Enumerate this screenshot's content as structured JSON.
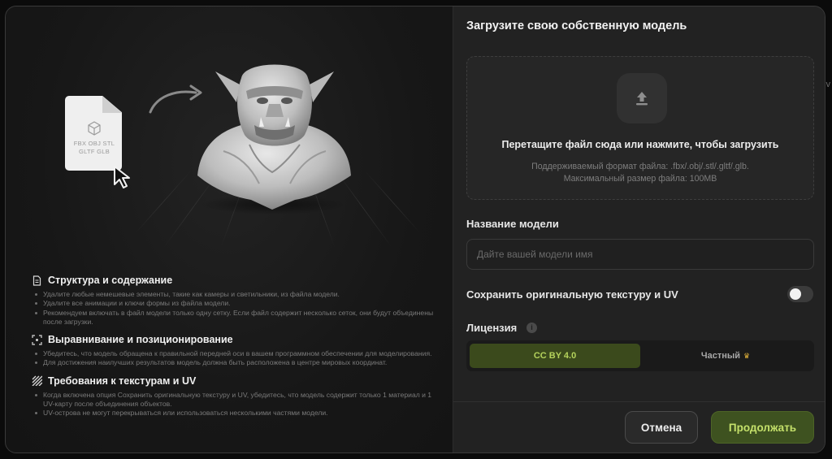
{
  "background": {
    "edge_text": "v"
  },
  "illustration": {
    "file_formats": [
      "FBX OBJ STL",
      "GLTF GLB"
    ],
    "icons": [
      "file-icon",
      "cube-icon",
      "cursor-icon",
      "curved-arrow-icon",
      "model-bust"
    ]
  },
  "guidelines": [
    {
      "icon": "document-icon",
      "title": "Структура и содержание",
      "items": [
        "Удалите любые немешевые элементы, такие как камеры и светильники, из файла модели.",
        "Удалите все анимации и ключи формы из файла модели.",
        "Рекомендуем включать в файл модели только одну сетку. Если файл содержит несколько сеток, они будут объединены после загрузки."
      ]
    },
    {
      "icon": "focus-frame-icon",
      "title": "Выравнивание и позиционирование",
      "items": [
        "Убедитесь, что модель обращена к правильной передней оси в вашем программном обеспечении для моделирования.",
        "Для достижения наилучших результатов модель должна быть расположена в центре мировых координат."
      ]
    },
    {
      "icon": "texture-stripes-icon",
      "title": "Требования к текстурам и UV",
      "items": [
        "Когда включена опция Сохранить оригинальную текстуру и UV, убедитесь, что модель содержит только 1 материал и 1 UV-карту после объединения объектов.",
        "UV-острова не могут перекрываться или использоваться несколькими частями модели."
      ]
    }
  ],
  "panel": {
    "title": "Загрузите свою собственную модель",
    "dropzone": {
      "main": "Перетащите файл сюда или нажмите, чтобы загрузить",
      "formats": "Поддерживаемый формат файла: .fbx/.obj/.stl/.gltf/.glb.",
      "max_size": "Максимальный размер файла: 100MB"
    },
    "name_label": "Название модели",
    "name_placeholder": "Дайте вашей модели имя",
    "name_value": "",
    "keep_texture_label": "Сохранить оригинальную текстуру и UV",
    "keep_texture_on": false,
    "license_label": "Лицензия",
    "license_options": [
      "CC BY 4.0",
      "Частный"
    ],
    "license_selected": "CC BY 4.0",
    "cancel": "Отмена",
    "continue": "Продолжать"
  },
  "colors": {
    "accent_bg": "#3e5220",
    "accent_text": "#c4e06a",
    "crown": "#e2b23a"
  }
}
